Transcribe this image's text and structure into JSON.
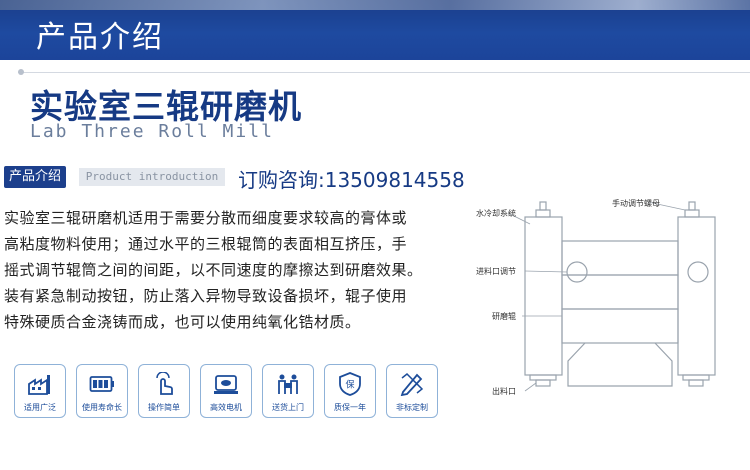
{
  "header": {
    "title": "产品介绍"
  },
  "product": {
    "title": "实验室三辊研磨机",
    "subtitle_en": "Lab Three Roll Mill"
  },
  "section": {
    "badge": "产品介绍",
    "badge_en": "Product introduction",
    "hotline": "订购咨询:13509814558"
  },
  "description": [
    "实验室三辊研磨机适用于需要分散而细度要求较高的膏体或",
    "高粘度物料使用；通过水平的三根辊筒的表面相互挤压，手",
    "摇式调节辊筒之间的间距，以不同速度的摩擦达到研磨效果。",
    "装有紧急制动按钮，防止落入异物导致设备损坏，辊子使用",
    "特殊硬质合金浇铸而成，也可以使用纯氧化锆材质。"
  ],
  "features": [
    {
      "label": "适用广泛",
      "icon": "factory-icon"
    },
    {
      "label": "使用寿命长",
      "icon": "battery-icon"
    },
    {
      "label": "操作简单",
      "icon": "hand-click-icon"
    },
    {
      "label": "高效电机",
      "icon": "motor-icon"
    },
    {
      "label": "送货上门",
      "icon": "delivery-icon"
    },
    {
      "label": "质保一年",
      "icon": "shield-icon"
    },
    {
      "label": "非标定制",
      "icon": "pencil-ruler-icon"
    }
  ],
  "diagram": {
    "labels": {
      "cooling": "水冷却系统",
      "nut": "手动调节螺母",
      "inlet": "进料口调节",
      "rollers": "研磨辊",
      "outlet": "出料口"
    }
  },
  "colors": {
    "brand": "#1c3f8c",
    "accent": "#1e4aa0",
    "icon": "#1d4d9a"
  }
}
